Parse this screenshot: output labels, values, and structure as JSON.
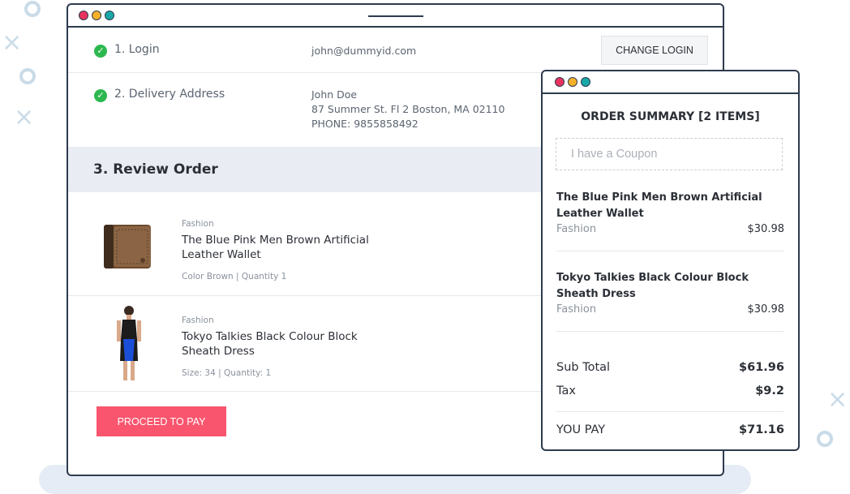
{
  "steps": {
    "login": {
      "label": "1. Login",
      "value": "john@dummyid.com",
      "button": "CHANGE LOGIN"
    },
    "delivery": {
      "label": "2. Delivery Address",
      "name": "John Doe",
      "address": "87 Summer St. Fl 2 Boston, MA 02110",
      "phone": "PHONE: 9855858492"
    },
    "review": {
      "title": "3. Review Order"
    }
  },
  "products": [
    {
      "category": "Fashion",
      "name": "The Blue Pink Men Brown Artificial Leather Wallet",
      "meta": "Color Brown | Quantity 1"
    },
    {
      "category": "Fashion",
      "name": "Tokyo Talkies Black Colour Block Sheath Dress",
      "meta": "Size: 34 | Quantity: 1"
    }
  ],
  "pay_button": "PROCEED TO PAY",
  "summary": {
    "title": "ORDER SUMMARY [2 ITEMS]",
    "coupon_placeholder": "I have a Coupon",
    "items": [
      {
        "name": "The Blue Pink Men Brown Artificial Leather Wallet",
        "category": "Fashion",
        "price": "$30.98"
      },
      {
        "name": "Tokyo Talkies Black Colour Block Sheath Dress",
        "category": "Fashion",
        "price": "$30.98"
      }
    ],
    "subtotal_label": "Sub Total",
    "subtotal": "$61.96",
    "tax_label": "Tax",
    "tax": "$9.2",
    "total_label": "YOU PAY",
    "total": "$71.16"
  },
  "colors": {
    "accent": "#f9556e",
    "check": "#2db84f",
    "frame": "#2e3b4e"
  }
}
